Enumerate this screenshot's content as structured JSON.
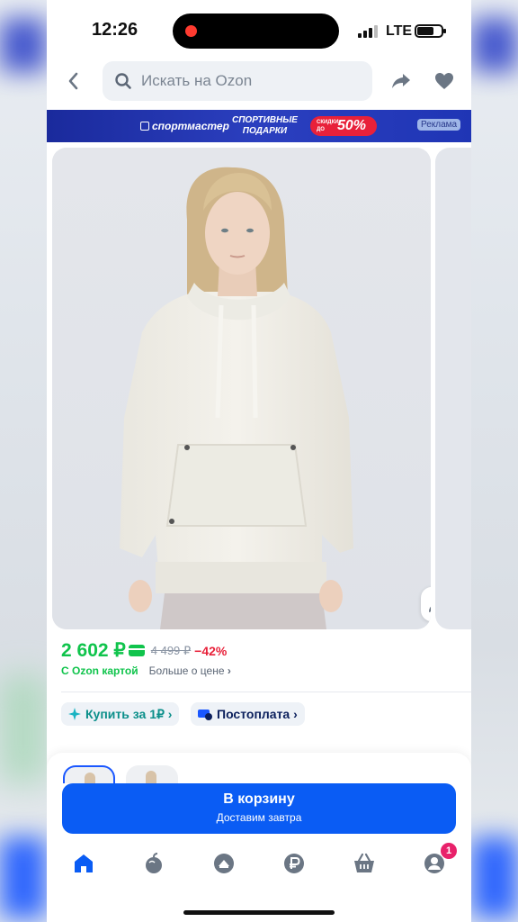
{
  "status": {
    "time": "12:26",
    "network": "LTE"
  },
  "search": {
    "placeholder": "Искать на Ozon"
  },
  "banner": {
    "brand": "спортмастер",
    "tagline_1": "СПОРТИВНЫЕ",
    "tagline_2": "ПОДАРКИ",
    "sale_small": "скидки до",
    "sale_value": "50%",
    "ad_label": "Реклама"
  },
  "product": {
    "price": "2 602 ₽",
    "old_price": "4 499 ₽",
    "discount": "−42%",
    "ozon_card_label": "С Ozon картой",
    "more_price_label": "Больше о цене",
    "buy_for_label": "Купить за 1₽",
    "postpay_label": "Постоплата"
  },
  "cart": {
    "title": "В корзину",
    "subtitle": "Доставим завтра"
  },
  "tabbar": {
    "cart_badge": "1"
  },
  "colors": {
    "accent": "#0a5cf4",
    "price_green": "#10c44c",
    "discount_red": "#e8213a",
    "badge": "#e8216a"
  }
}
